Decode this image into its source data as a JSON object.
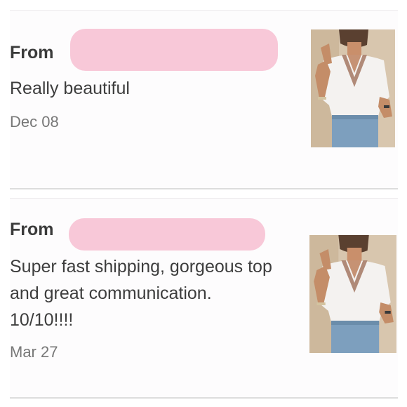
{
  "reviews": [
    {
      "from_label": "From",
      "text": "Really beautiful",
      "date": "Dec 08",
      "image_icon": "product-photo-icon"
    },
    {
      "from_label": "From",
      "text": "Super fast shipping, gorgeous top and great communication. 10/10!!!!",
      "date": "Mar 27",
      "image_icon": "product-photo-icon"
    }
  ],
  "colors": {
    "card_bg": "#fdfcfd",
    "redaction": "#f8c8d8",
    "text": "#3d3d3d",
    "date": "#777777"
  }
}
